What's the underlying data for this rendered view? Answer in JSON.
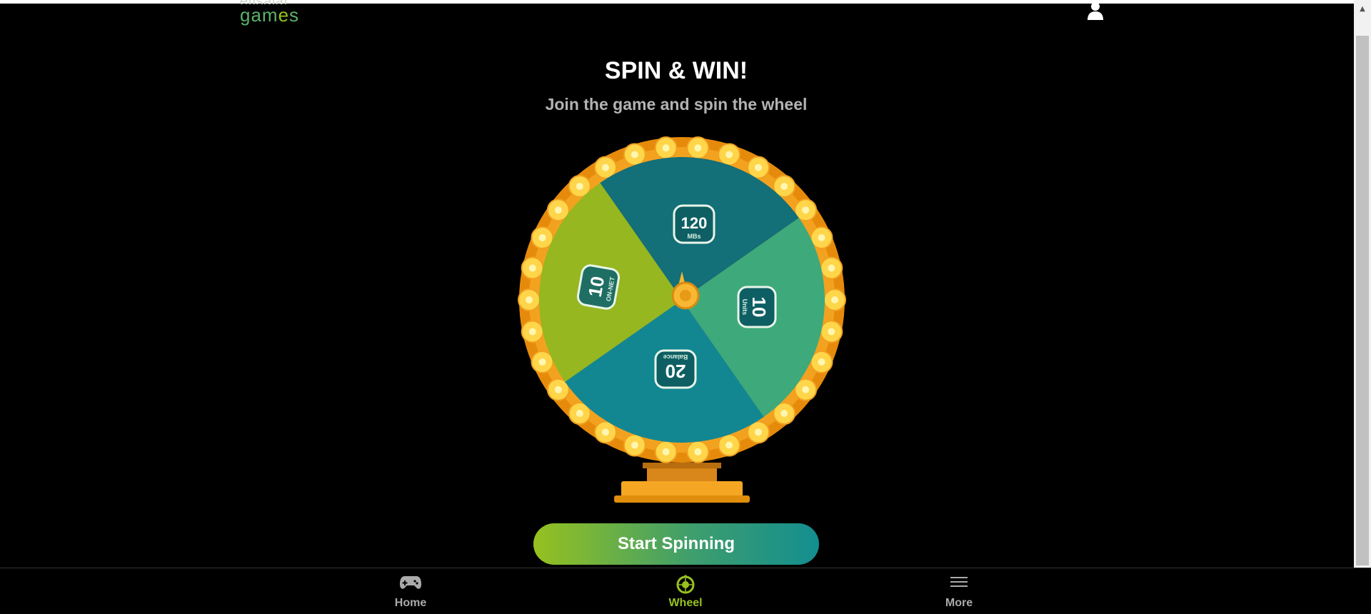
{
  "header": {
    "logo_top": "etisalat",
    "logo_bottom": "gam",
    "logo_accent": "e",
    "logo_end": "s"
  },
  "hero": {
    "title": "SPIN & WIN!",
    "subtitle": "Join the game and spin the wheel"
  },
  "wheel": {
    "prizes": [
      {
        "big": "120",
        "small": "MBs"
      },
      {
        "big": "10",
        "small": "Units"
      },
      {
        "big": "20",
        "small": "Balance"
      },
      {
        "big": "10",
        "small": "ON-NET"
      }
    ],
    "segment_colors": [
      "#136f78",
      "#3ea97a",
      "#128792",
      "#96b720"
    ],
    "rim_color": "#f39c12",
    "bulb_color": "#ffd54a"
  },
  "cta": {
    "label": "Start Spinning"
  },
  "nav": {
    "items": [
      {
        "label": "Home",
        "icon": "gamepad-icon"
      },
      {
        "label": "Wheel",
        "icon": "wheel-icon",
        "active": true
      },
      {
        "label": "More",
        "icon": "menu-icon"
      }
    ]
  },
  "colors": {
    "accent": "#96c11f",
    "teal": "#138e90"
  }
}
